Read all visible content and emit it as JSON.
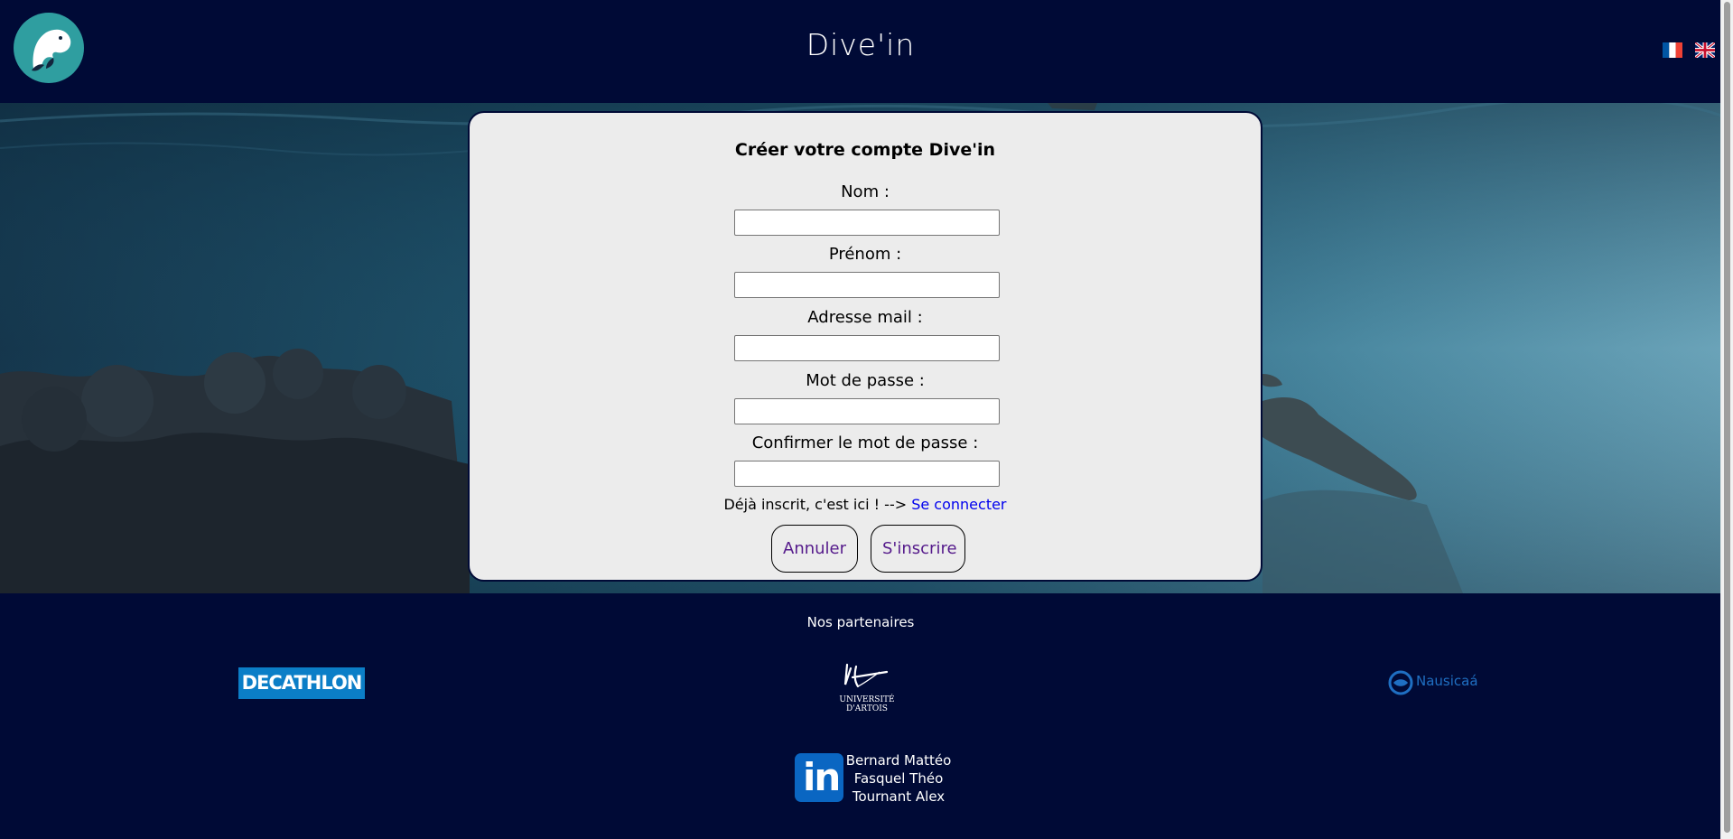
{
  "header": {
    "title": "Dive'in",
    "languages": [
      {
        "code": "fr",
        "icon": "flag-fr-icon"
      },
      {
        "code": "en",
        "icon": "flag-uk-icon"
      }
    ]
  },
  "form": {
    "title": "Créer votre compte Dive'in",
    "fields": [
      {
        "label": "Nom :",
        "value": "",
        "placeholder": ""
      },
      {
        "label": "Prénom :",
        "value": "",
        "placeholder": ""
      },
      {
        "label": "Adresse mail :",
        "value": "",
        "placeholder": ""
      },
      {
        "label": "Mot de passe :",
        "value": "",
        "placeholder": ""
      },
      {
        "label": "Confirmer le mot de passe :",
        "value": "",
        "placeholder": ""
      }
    ],
    "login_prompt": "Déjà inscrit, c'est ici ! -->",
    "login_link": "Se connecter",
    "cancel_label": "Annuler",
    "submit_label": "S'inscrire"
  },
  "footer": {
    "partners_title": "Nos partenaires",
    "partners": [
      {
        "name": "DECATHLON",
        "icon": "decathlon-logo"
      },
      {
        "name": "UNIVERSITÉ D'ARTOIS",
        "icon": "artois-logo"
      },
      {
        "name": "Nausicaá",
        "icon": "nausicaa-logo"
      }
    ],
    "authors": [
      "Bernard Mattéo",
      "Fasquel Théo",
      "Tournant Alex"
    ],
    "linkedin_label": "in"
  },
  "colors": {
    "navy": "#000a36",
    "card": "#ececec",
    "link": "#0000ee",
    "button_text": "#551a8b",
    "logo_teal": "#2f9ea0",
    "decathlon_blue": "#0b7ec7",
    "linkedin_blue": "#0a66c2"
  }
}
